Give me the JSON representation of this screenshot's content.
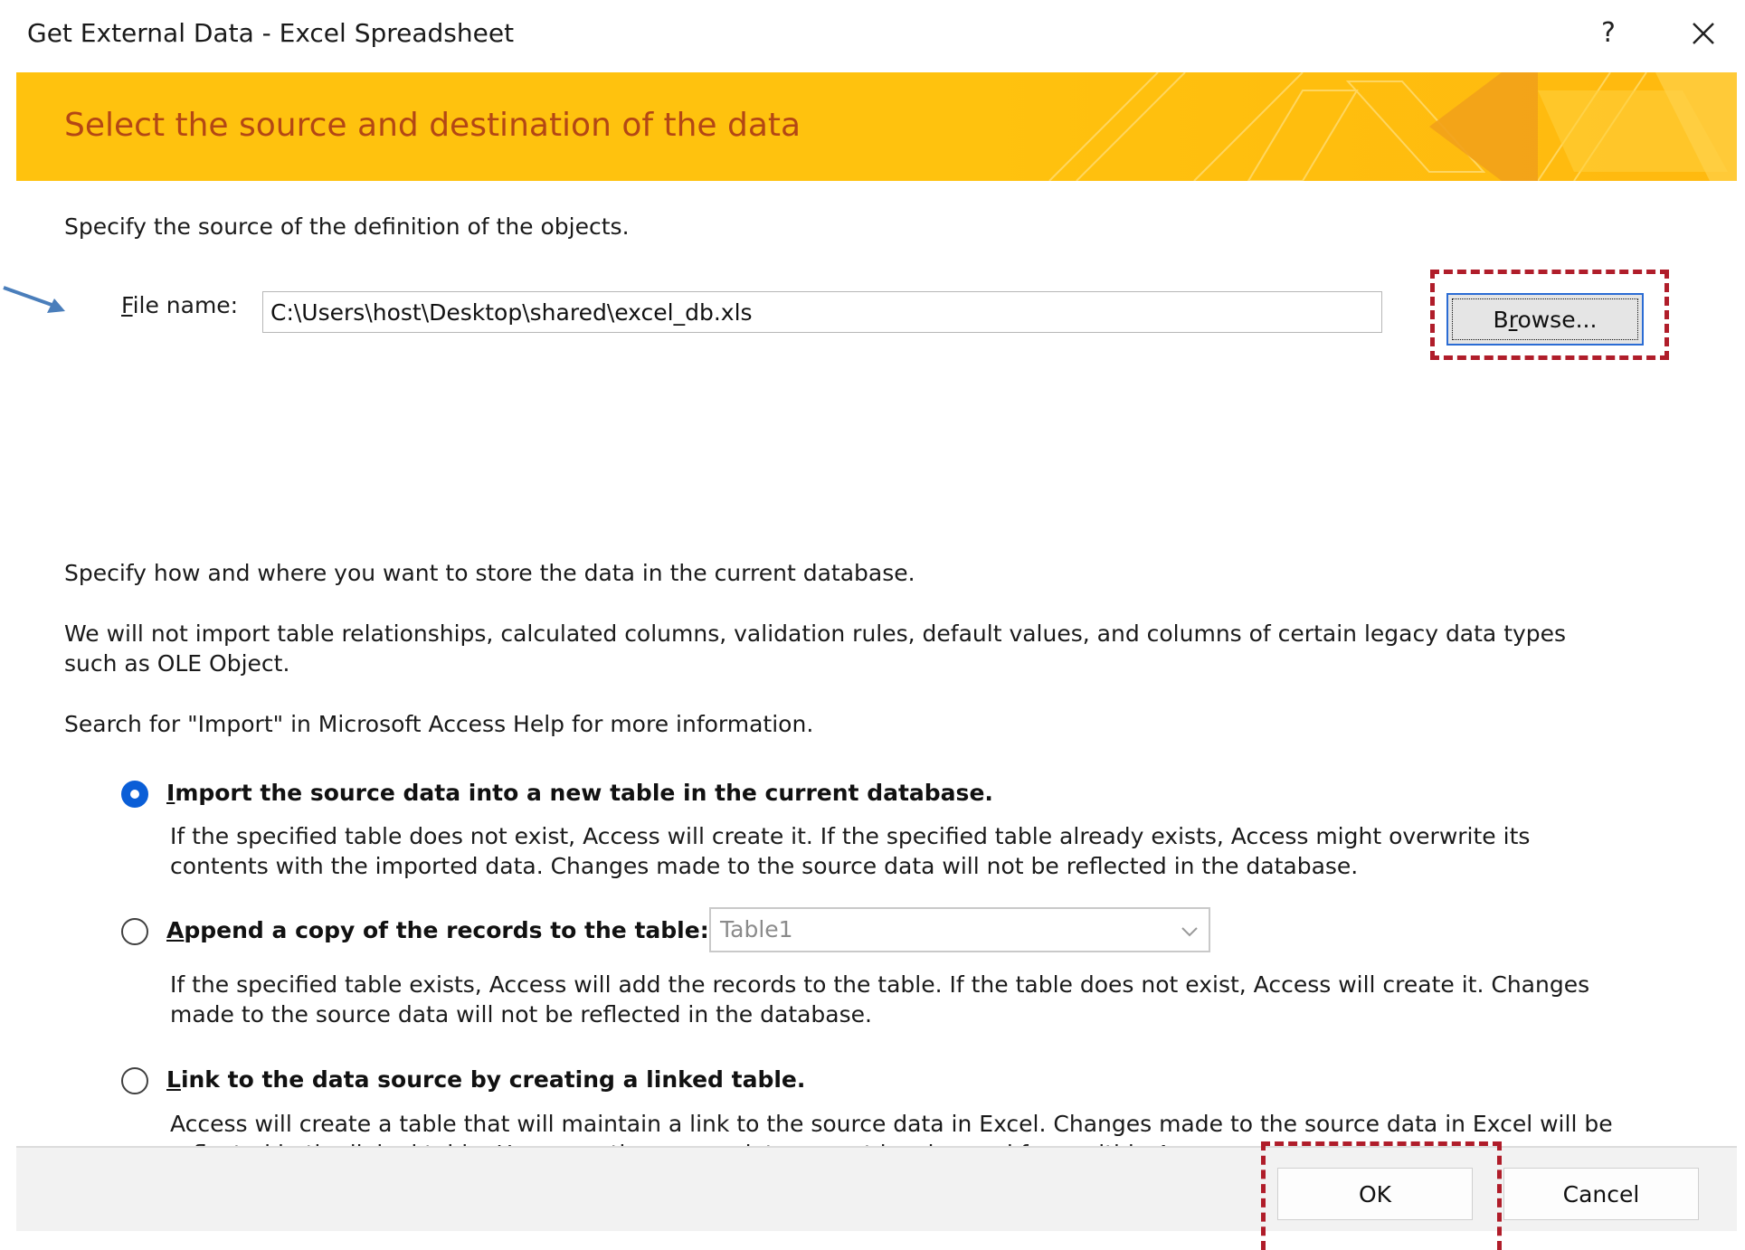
{
  "window": {
    "title": "Get External Data - Excel Spreadsheet",
    "help_label": "?"
  },
  "banner": {
    "title": "Select the source and destination of the data"
  },
  "source": {
    "instruction": "Specify the source of the definition of the objects.",
    "file_label_accel": "F",
    "file_label_rest": "ile name:",
    "file_value": "C:\\Users\\host\\Desktop\\shared\\excel_db.xls",
    "browse_accel_pre": "B",
    "browse_accel": "r",
    "browse_rest": "owse..."
  },
  "destination": {
    "instruction": "Specify how and where you want to store the data in the current database.",
    "note_line1": "We will not import table relationships, calculated columns, validation rules, default values, and columns of certain legacy data types",
    "note_line2": "such as OLE Object.",
    "help_hint": "Search for \"Import\" in Microsoft Access Help for more information."
  },
  "options": [
    {
      "accel": "I",
      "label_rest": "mport the source data into a new table in the current database.",
      "selected": true,
      "desc_line1": "If the specified table does not exist, Access will create it. If the specified table already exists, Access might overwrite its",
      "desc_line2": "contents with the imported data. Changes made to the source data will not be reflected in the database."
    },
    {
      "accel": "A",
      "label_rest": "ppend a copy of the records to the table:",
      "selected": false,
      "table_value": "Table1",
      "desc_line1": "If the specified table exists, Access will add the records to the table. If the table does not exist, Access will create it. Changes",
      "desc_line2": "made to the source data will not be reflected in the database."
    },
    {
      "accel": "L",
      "label_rest": "ink to the data source by creating a linked table.",
      "selected": false,
      "desc_line1": "Access will create a table that will maintain a link to the source data in Excel. Changes made to the source data in Excel will be",
      "desc_line2": "reflected in the linked table. However, the source data cannot be changed from within Access."
    }
  ],
  "footer": {
    "ok_label": "OK",
    "cancel_label": "Cancel"
  },
  "colors": {
    "banner": "#ffc20e",
    "banner_title": "#b34715",
    "radio_selected": "#0a5ed7",
    "annotation": "#b01d2a",
    "arrow": "#4a7ebb"
  }
}
